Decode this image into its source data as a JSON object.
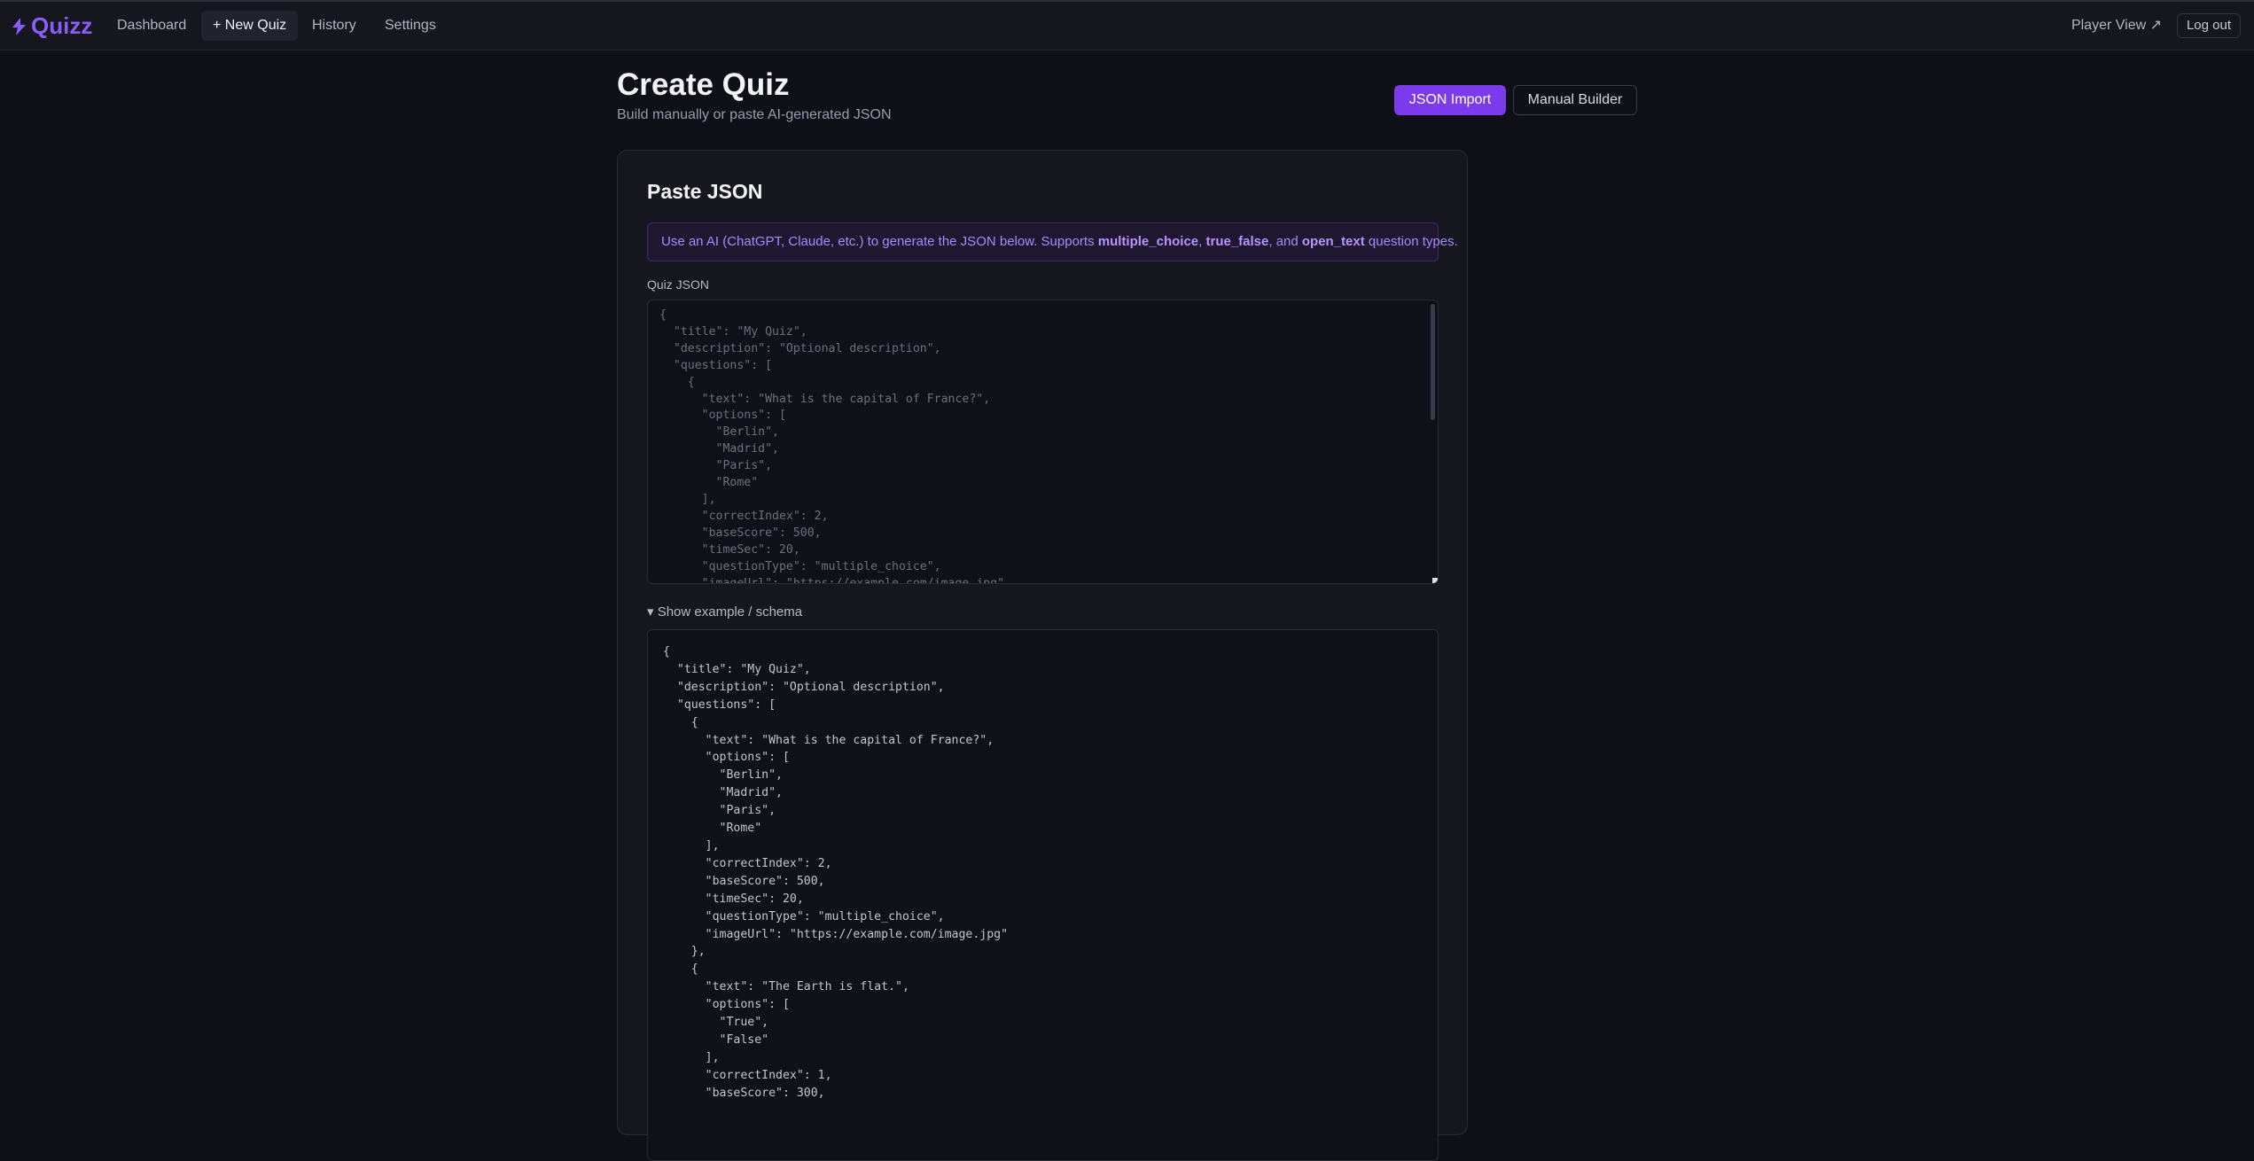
{
  "brand": {
    "name": "Quizz",
    "icon": "lightning-bolt-icon",
    "color": "#8b5cf6"
  },
  "nav": {
    "items": [
      {
        "label": "Dashboard"
      },
      {
        "label": "+ New Quiz"
      },
      {
        "label": "History"
      },
      {
        "label": "Settings"
      }
    ],
    "player_view": "Player View ↗",
    "logout": "Log out"
  },
  "header": {
    "title": "Create Quiz",
    "subtitle": "Build manually or paste AI-generated JSON",
    "tabs": {
      "json_import": "JSON Import",
      "manual_builder": "Manual Builder"
    }
  },
  "card": {
    "title": "Paste JSON",
    "info": {
      "prefix": "Use an AI (ChatGPT, Claude, etc.) to generate the JSON below. Supports ",
      "type1": "multiple_choice",
      "sep1": ", ",
      "type2": "true_false",
      "sep2": ", and ",
      "type3": "open_text",
      "suffix": " question types."
    },
    "field_label": "Quiz JSON",
    "json_placeholder": "{\n  \"title\": \"My Quiz\",\n  \"description\": \"Optional description\",\n  \"questions\": [\n    {\n      \"text\": \"What is the capital of France?\",\n      \"options\": [\n        \"Berlin\",\n        \"Madrid\",\n        \"Paris\",\n        \"Rome\"\n      ],\n      \"correctIndex\": 2,\n      \"baseScore\": 500,\n      \"timeSec\": 20,\n      \"questionType\": \"multiple_choice\",\n      \"imageUrl\": \"https://example.com/image.jpg\"\n    },",
    "details_summary": "▾ Show example / schema",
    "example_json": "{\n  \"title\": \"My Quiz\",\n  \"description\": \"Optional description\",\n  \"questions\": [\n    {\n      \"text\": \"What is the capital of France?\",\n      \"options\": [\n        \"Berlin\",\n        \"Madrid\",\n        \"Paris\",\n        \"Rome\"\n      ],\n      \"correctIndex\": 2,\n      \"baseScore\": 500,\n      \"timeSec\": 20,\n      \"questionType\": \"multiple_choice\",\n      \"imageUrl\": \"https://example.com/image.jpg\"\n    },\n    {\n      \"text\": \"The Earth is flat.\",\n      \"options\": [\n        \"True\",\n        \"False\"\n      ],\n      \"correctIndex\": 1,\n      \"baseScore\": 300,"
  },
  "colors": {
    "accent": "#7c3aed",
    "background": "#0f0f17",
    "surface": "#16161f"
  }
}
